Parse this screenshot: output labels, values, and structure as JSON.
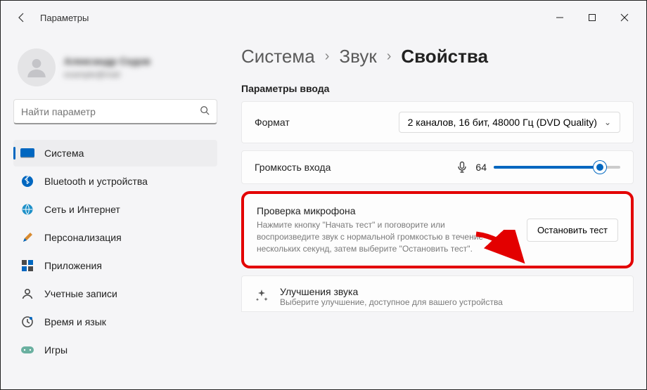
{
  "titlebar": {
    "title": "Параметры"
  },
  "user": {
    "name": "Александр Седов",
    "email": "example@mail"
  },
  "search": {
    "placeholder": "Найти параметр"
  },
  "nav": {
    "items": [
      {
        "label": "Система"
      },
      {
        "label": "Bluetooth и устройства"
      },
      {
        "label": "Сеть и Интернет"
      },
      {
        "label": "Персонализация"
      },
      {
        "label": "Приложения"
      },
      {
        "label": "Учетные записи"
      },
      {
        "label": "Время и язык"
      },
      {
        "label": "Игры"
      }
    ],
    "activeIndex": 0
  },
  "breadcrumb": {
    "level1": "Система",
    "level2": "Звук",
    "current": "Свойства"
  },
  "section": "Параметры ввода",
  "format": {
    "label": "Формат",
    "value": "2 каналов, 16 бит, 48000 Гц (DVD Quality)"
  },
  "volume": {
    "label": "Громкость входа",
    "value": "64",
    "percent": 84
  },
  "micTest": {
    "title": "Проверка микрофона",
    "desc": "Нажмите кнопку \"Начать тест\" и поговорите или воспроизведите звук с нормальной громкостью в течение нескольких секунд, затем выберите \"Остановить тест\".",
    "button": "Остановить тест"
  },
  "enhance": {
    "title": "Улучшения звука",
    "desc": "Выберите улучшение, доступное для вашего устройства"
  }
}
